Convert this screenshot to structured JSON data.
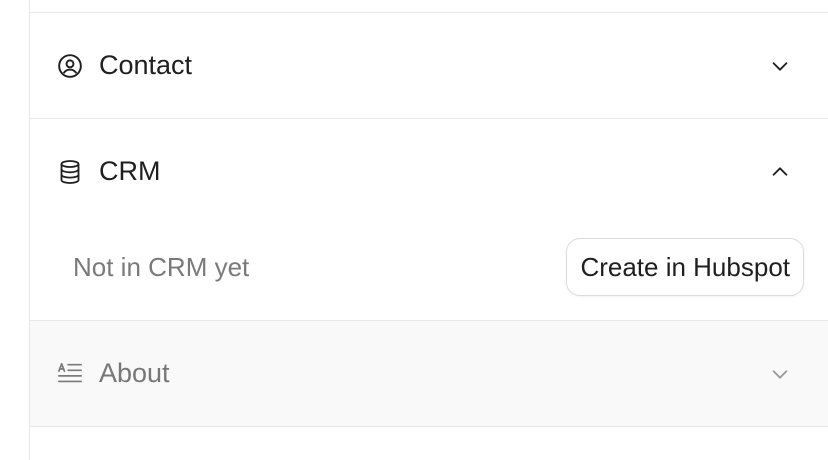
{
  "sections": {
    "contact": {
      "title": "Contact",
      "icon": "user-circle-icon",
      "expanded": false
    },
    "crm": {
      "title": "CRM",
      "icon": "database-icon",
      "expanded": true,
      "status_text": "Not in CRM yet",
      "action_label": "Create in Hubspot"
    },
    "about": {
      "title": "About",
      "icon": "text-align-icon",
      "expanded": false
    }
  },
  "colors": {
    "text": "#1f1f1f",
    "muted_text": "#7a7a7a",
    "border": "#e8e8e8",
    "muted_bg": "#f9f9f9"
  }
}
